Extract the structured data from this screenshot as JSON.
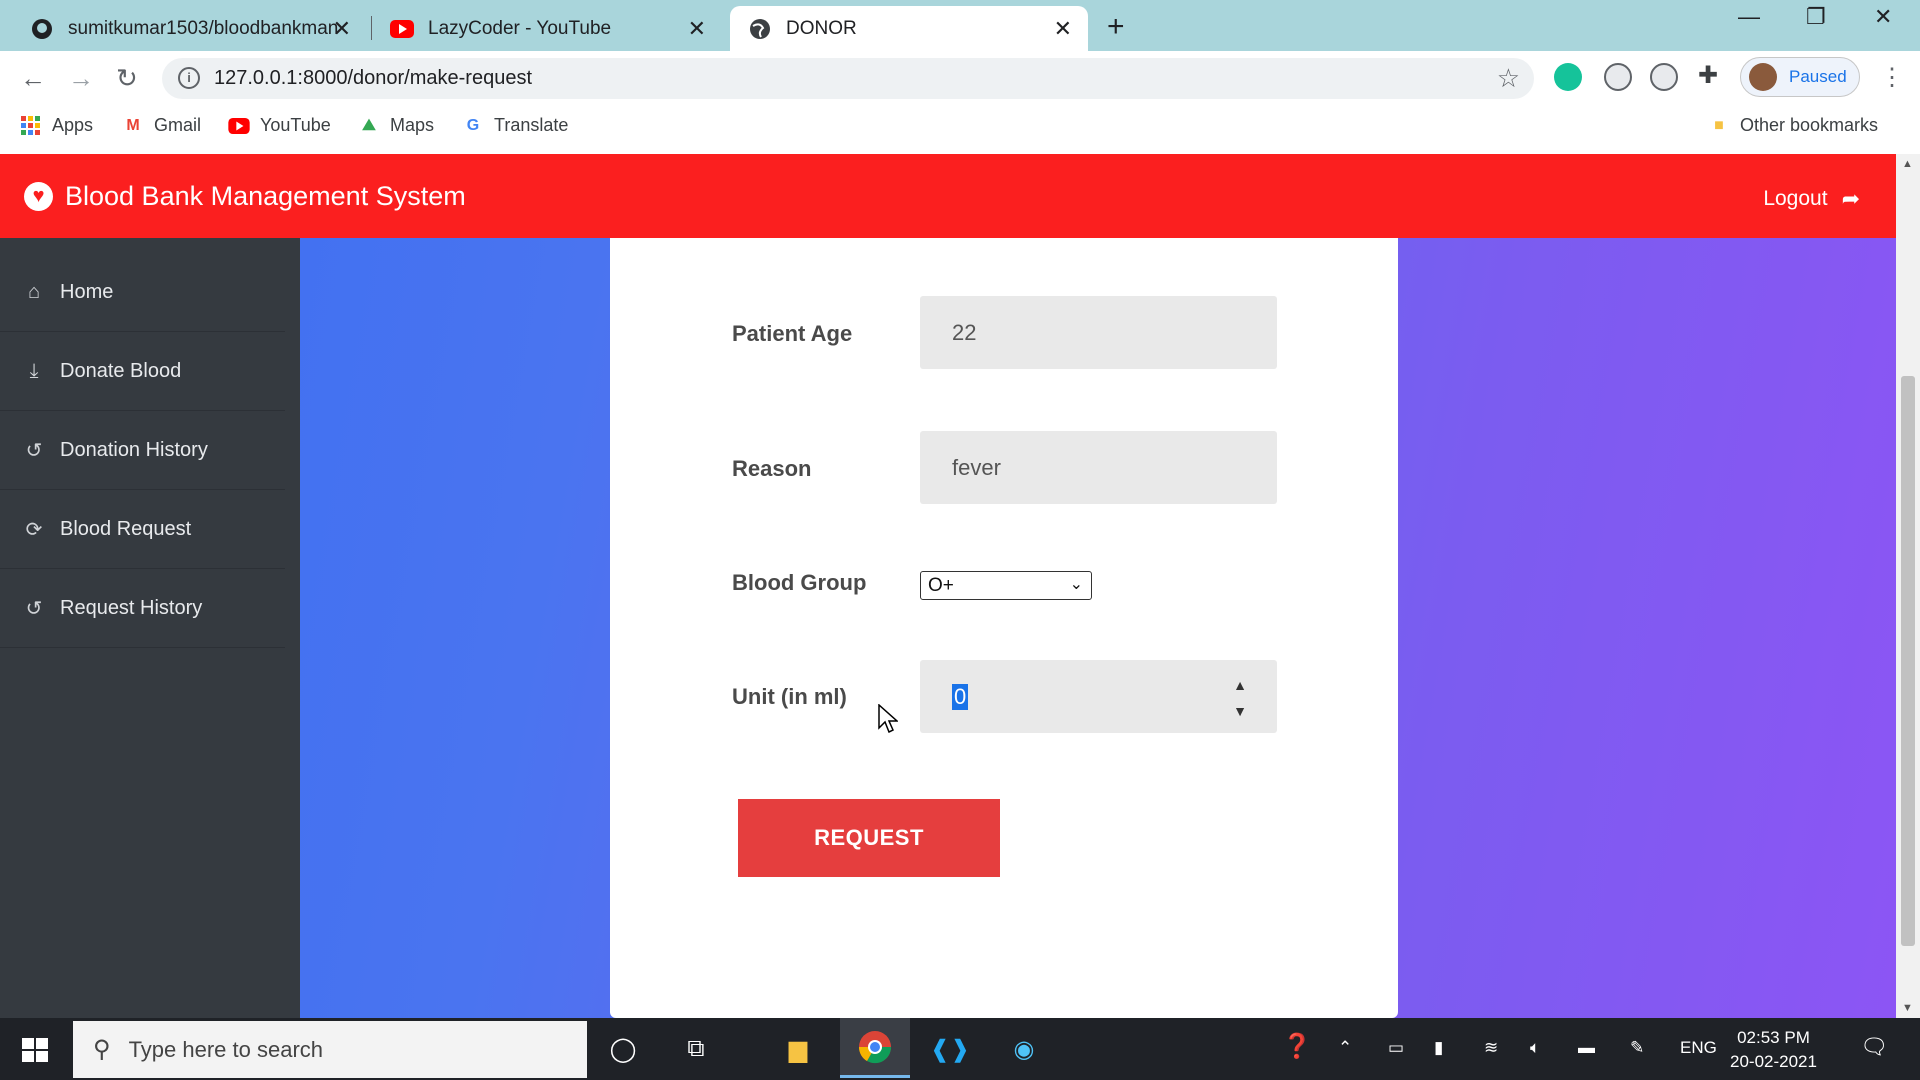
{
  "browser": {
    "tabs": [
      {
        "title": "sumitkumar1503/bloodbankman",
        "icon": "github-icon"
      },
      {
        "title": "LazyCoder - YouTube",
        "icon": "youtube-icon"
      },
      {
        "title": "DONOR",
        "icon": "globe-icon",
        "active": true
      }
    ],
    "url": "127.0.0.1:8000/donor/make-request",
    "profile_label": "Paused",
    "bookmarks": [
      {
        "label": "Apps",
        "icon": "apps-grid-icon"
      },
      {
        "label": "Gmail",
        "icon": "gmail-icon"
      },
      {
        "label": "YouTube",
        "icon": "youtube-icon"
      },
      {
        "label": "Maps",
        "icon": "maps-icon"
      },
      {
        "label": "Translate",
        "icon": "translate-icon"
      }
    ],
    "other_bookmarks": "Other bookmarks"
  },
  "app": {
    "brand": "Blood Bank Management System",
    "logout": "Logout",
    "sidebar": [
      {
        "label": "Home",
        "icon": "home-icon"
      },
      {
        "label": "Donate Blood",
        "icon": "donate-icon"
      },
      {
        "label": "Donation History",
        "icon": "history-icon"
      },
      {
        "label": "Blood Request",
        "icon": "refresh-icon"
      },
      {
        "label": "Request History",
        "icon": "history-icon"
      }
    ],
    "form": {
      "age_label": "Patient Age",
      "age_value": "22",
      "reason_label": "Reason",
      "reason_value": "fever",
      "group_label": "Blood Group",
      "group_value": "O+",
      "unit_label": "Unit (in ml)",
      "unit_value": "0",
      "submit": "REQUEST"
    },
    "colors": {
      "navbar": "#fb1f1f",
      "sidebar": "#353a40",
      "button": "#e53e3e"
    }
  },
  "taskbar": {
    "search_placeholder": "Type here to search",
    "lang": "ENG",
    "time": "02:53 PM",
    "date": "20-02-2021"
  }
}
